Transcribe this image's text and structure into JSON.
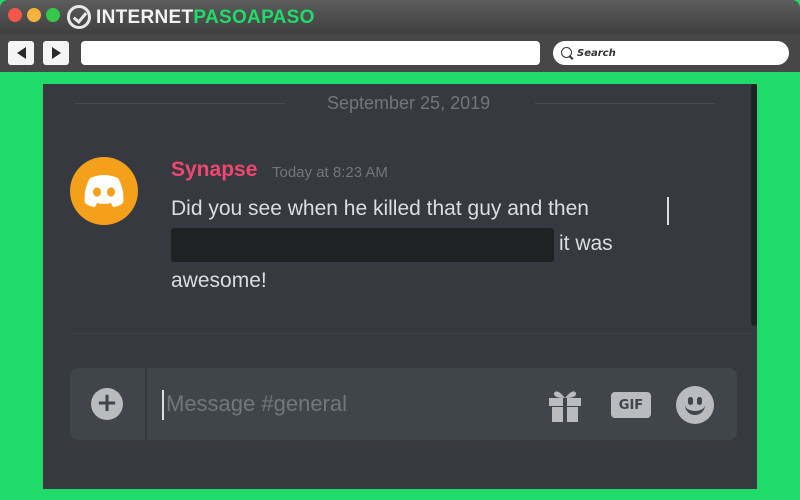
{
  "browser": {
    "logo": {
      "part1": "INTERNET",
      "part2": "PASOAPASO"
    },
    "search": {
      "label": "Search"
    }
  },
  "chat": {
    "date_divider": "September 25, 2019",
    "message": {
      "username": "Synapse",
      "timestamp": "Today at 8:23 AM",
      "line1": "Did you see when he killed that guy and then",
      "line2_after_spoiler": "it was",
      "line3": "awesome!"
    },
    "composer": {
      "placeholder": "Message #general",
      "add_label": "+",
      "gif_label": "GIF"
    }
  },
  "colors": {
    "page_background": "#1fdc6a",
    "chat_background": "#36393f",
    "username": "#f04770",
    "avatar": "#f5a01a",
    "spoiler": "#1f2123"
  },
  "icons": [
    "logo-check-icon",
    "back-arrow-icon",
    "forward-arrow-icon",
    "search-icon",
    "discord-logo-icon",
    "add-icon",
    "gift-icon",
    "gif-icon",
    "emoji-icon"
  ]
}
